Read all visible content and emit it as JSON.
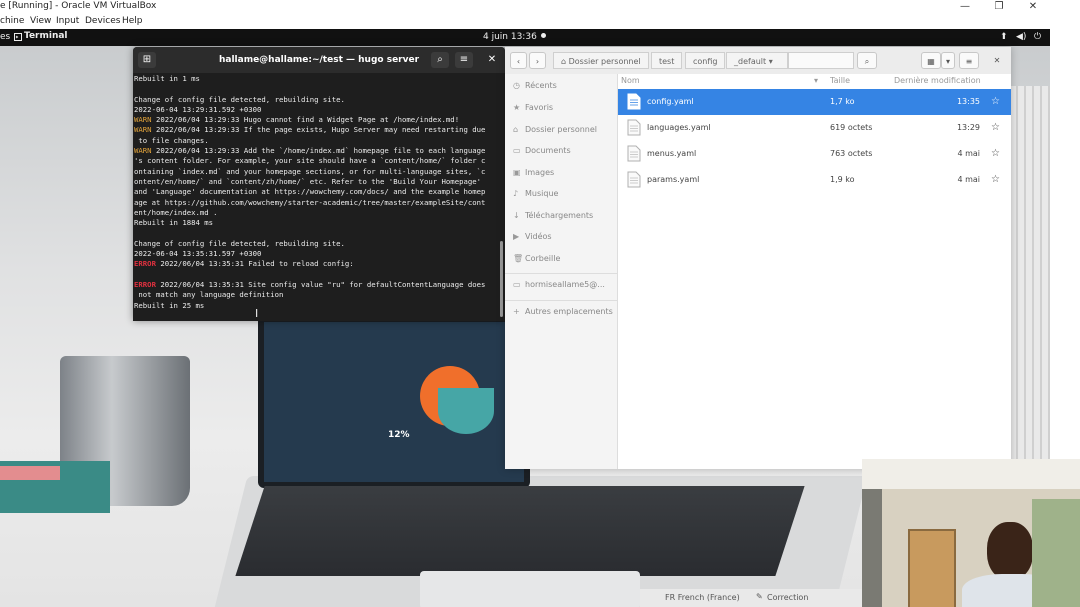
{
  "host": {
    "title": "e [Running] - Oracle VM VirtualBox",
    "menu": [
      "chine",
      "View",
      "Input",
      "Devices",
      "Help"
    ],
    "win_controls": [
      "—",
      "❐",
      "✕"
    ]
  },
  "gnome": {
    "activities": "es",
    "app": "Terminal",
    "clock": "4 juin  13:36"
  },
  "terminal": {
    "title": "hallame@hallame:~/test — hugo server",
    "lines": [
      {
        "t": "Rebuilt in 1 ms",
        "k": ""
      },
      {
        "t": "",
        "k": ""
      },
      {
        "t": "Change of config file detected, rebuilding site.",
        "k": ""
      },
      {
        "t": "2022-06-04 13:29:31.592 +0300",
        "k": ""
      },
      {
        "p": "WARN",
        "t": " 2022/06/04 13:29:33 Hugo cannot find a Widget Page at /home/index.md!",
        "k": "warn"
      },
      {
        "p": "WARN",
        "t": " 2022/06/04 13:29:33 If the page exists, Hugo Server may need restarting due",
        "k": "warn"
      },
      {
        "t": " to file changes.",
        "k": ""
      },
      {
        "p": "WARN",
        "t": " 2022/06/04 13:29:33 Add the `/home/index.md` homepage file to each language",
        "k": "warn"
      },
      {
        "t": "'s content folder. For example, your site should have a `content/home/` folder c",
        "k": ""
      },
      {
        "t": "ontaining `index.md` and your homepage sections, or for multi-language sites, `c",
        "k": ""
      },
      {
        "t": "ontent/en/home/` and `content/zh/home/` etc. Refer to the 'Build Your Homepage'",
        "k": ""
      },
      {
        "t": "and 'Language' documentation at https://wowchemy.com/docs/ and the example homep",
        "k": ""
      },
      {
        "t": "age at https://github.com/wowchemy/starter-academic/tree/master/exampleSite/cont",
        "k": ""
      },
      {
        "t": "ent/home/index.md .",
        "k": ""
      },
      {
        "t": "Rebuilt in 1884 ms",
        "k": ""
      },
      {
        "t": "",
        "k": ""
      },
      {
        "t": "Change of config file detected, rebuilding site.",
        "k": ""
      },
      {
        "t": "2022-06-04 13:35:31.597 +0300",
        "k": ""
      },
      {
        "p": "ERROR",
        "t": " 2022/06/04 13:35:31 Failed to reload config:",
        "k": "err"
      },
      {
        "t": "",
        "k": ""
      },
      {
        "p": "ERROR",
        "t": " 2022/06/04 13:35:31 Site config value \"ru\" for defaultContentLanguage does",
        "k": "err"
      },
      {
        "t": " not match any language definition",
        "k": ""
      },
      {
        "t": "Rebuilt in 25 ms",
        "k": ""
      }
    ]
  },
  "files": {
    "breadcrumbs": [
      "Dossier personnel",
      "test",
      "config",
      "_default"
    ],
    "columns": {
      "name": "Nom",
      "size": "Taille",
      "modified": "Dernière modification"
    },
    "sidebar": [
      {
        "label": "Récents",
        "icon": "clock-icon",
        "glyph": "◷"
      },
      {
        "label": "Favoris",
        "icon": "star-icon",
        "glyph": "★"
      },
      {
        "label": "Dossier personnel",
        "icon": "home-icon",
        "glyph": "⌂"
      },
      {
        "label": "Documents",
        "icon": "document-icon",
        "glyph": "▭"
      },
      {
        "label": "Images",
        "icon": "image-icon",
        "glyph": "▣"
      },
      {
        "label": "Musique",
        "icon": "music-icon",
        "glyph": "♪"
      },
      {
        "label": "Téléchargements",
        "icon": "download-icon",
        "glyph": "↓"
      },
      {
        "label": "Vidéos",
        "icon": "video-icon",
        "glyph": "▶"
      },
      {
        "label": "Corbeille",
        "icon": "trash-icon",
        "glyph": "🗑"
      },
      {
        "label": "hormiseallame5@...",
        "icon": "network-icon",
        "glyph": "▭"
      },
      {
        "label": "Autres emplacements",
        "icon": "plus-icon",
        "glyph": "+"
      }
    ],
    "rows": [
      {
        "name": "config.yaml",
        "size": "1,7 ko",
        "date": "13:35",
        "selected": true
      },
      {
        "name": "languages.yaml",
        "size": "619 octets",
        "date": "13:29",
        "selected": false
      },
      {
        "name": "menus.yaml",
        "size": "763 octets",
        "date": "4 mai",
        "selected": false
      },
      {
        "name": "params.yaml",
        "size": "1,9 ko",
        "date": "4 mai",
        "selected": false
      }
    ]
  },
  "wallpaper": {
    "chart_label": "12%"
  },
  "status": {
    "language": "FR French (France)",
    "correction": "Correction"
  }
}
